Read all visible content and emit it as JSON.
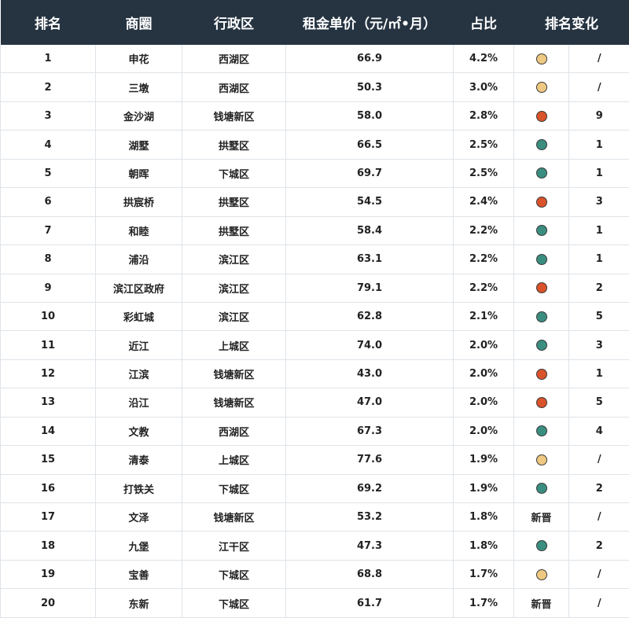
{
  "header": {
    "rank": "排名",
    "area": "商圈",
    "district": "行政区",
    "rent": "租金单价（元/㎡•月）",
    "share": "占比",
    "change": "排名变化"
  },
  "colors": {
    "header_bg": "#263442",
    "up": "#3a8e80",
    "down": "#d9532a",
    "flat": "#efc981"
  },
  "rows": [
    {
      "rank": "1",
      "area": "申花",
      "district": "西湖区",
      "rent": "66.9",
      "share": "4.2%",
      "status": "flat",
      "change": "/"
    },
    {
      "rank": "2",
      "area": "三墩",
      "district": "西湖区",
      "rent": "50.3",
      "share": "3.0%",
      "status": "flat",
      "change": "/"
    },
    {
      "rank": "3",
      "area": "金沙湖",
      "district": "钱塘新区",
      "rent": "58.0",
      "share": "2.8%",
      "status": "down",
      "change": "9"
    },
    {
      "rank": "4",
      "area": "湖墅",
      "district": "拱墅区",
      "rent": "66.5",
      "share": "2.5%",
      "status": "up",
      "change": "1"
    },
    {
      "rank": "5",
      "area": "朝晖",
      "district": "下城区",
      "rent": "69.7",
      "share": "2.5%",
      "status": "up",
      "change": "1"
    },
    {
      "rank": "6",
      "area": "拱宸桥",
      "district": "拱墅区",
      "rent": "54.5",
      "share": "2.4%",
      "status": "down",
      "change": "3"
    },
    {
      "rank": "7",
      "area": "和睦",
      "district": "拱墅区",
      "rent": "58.4",
      "share": "2.2%",
      "status": "up",
      "change": "1"
    },
    {
      "rank": "8",
      "area": "浦沿",
      "district": "滨江区",
      "rent": "63.1",
      "share": "2.2%",
      "status": "up",
      "change": "1"
    },
    {
      "rank": "9",
      "area": "滨江区政府",
      "district": "滨江区",
      "rent": "79.1",
      "share": "2.2%",
      "status": "down",
      "change": "2"
    },
    {
      "rank": "10",
      "area": "彩虹城",
      "district": "滨江区",
      "rent": "62.8",
      "share": "2.1%",
      "status": "up",
      "change": "5"
    },
    {
      "rank": "11",
      "area": "近江",
      "district": "上城区",
      "rent": "74.0",
      "share": "2.0%",
      "status": "up",
      "change": "3"
    },
    {
      "rank": "12",
      "area": "江滨",
      "district": "钱塘新区",
      "rent": "43.0",
      "share": "2.0%",
      "status": "down",
      "change": "1"
    },
    {
      "rank": "13",
      "area": "沿江",
      "district": "钱塘新区",
      "rent": "47.0",
      "share": "2.0%",
      "status": "down",
      "change": "5"
    },
    {
      "rank": "14",
      "area": "文教",
      "district": "西湖区",
      "rent": "67.3",
      "share": "2.0%",
      "status": "up",
      "change": "4"
    },
    {
      "rank": "15",
      "area": "清泰",
      "district": "上城区",
      "rent": "77.6",
      "share": "1.9%",
      "status": "flat",
      "change": "/"
    },
    {
      "rank": "16",
      "area": "打铁关",
      "district": "下城区",
      "rent": "69.2",
      "share": "1.9%",
      "status": "up",
      "change": "2"
    },
    {
      "rank": "17",
      "area": "文泽",
      "district": "钱塘新区",
      "rent": "53.2",
      "share": "1.8%",
      "status": "new",
      "new_label": "新晋",
      "change": "/"
    },
    {
      "rank": "18",
      "area": "九堡",
      "district": "江干区",
      "rent": "47.3",
      "share": "1.8%",
      "status": "up",
      "change": "2"
    },
    {
      "rank": "19",
      "area": "宝善",
      "district": "下城区",
      "rent": "68.8",
      "share": "1.7%",
      "status": "flat",
      "change": "/"
    },
    {
      "rank": "20",
      "area": "东新",
      "district": "下城区",
      "rent": "61.7",
      "share": "1.7%",
      "status": "new",
      "new_label": "新晋",
      "change": "/"
    }
  ]
}
